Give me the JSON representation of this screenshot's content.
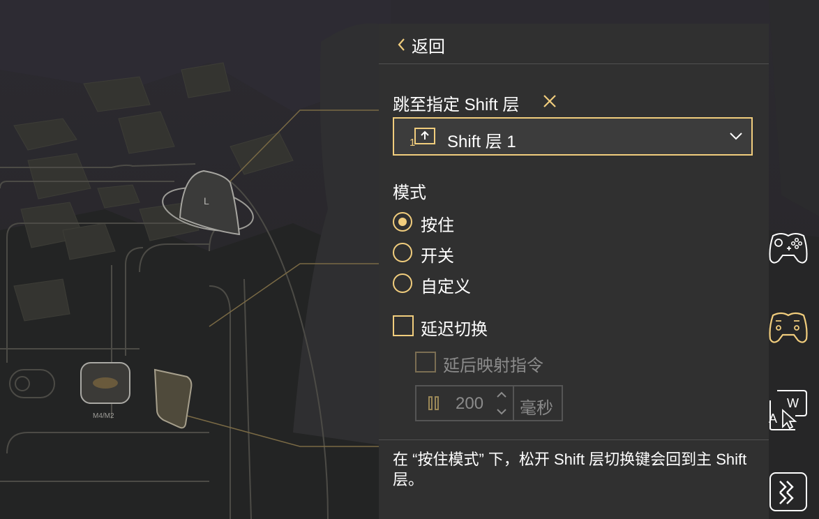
{
  "background": {
    "stick_label": "L",
    "paddle_label": "M4/M2"
  },
  "panel": {
    "back_label": "返回",
    "jump_title": "跳至指定 Shift 层",
    "clear_icon": "close-icon",
    "dropdown": {
      "icon": "shift-layer-icon",
      "selected": "Shift 层 1"
    },
    "mode_title": "模式",
    "modes": [
      {
        "label": "按住",
        "selected": true
      },
      {
        "label": "开关",
        "selected": false
      },
      {
        "label": "自定义",
        "selected": false
      }
    ],
    "delay_toggle": {
      "label": "延迟切换",
      "checked": false
    },
    "delay_mapping": {
      "label": "延后映射指令",
      "checked": false,
      "enabled": false
    },
    "delay_stepper": {
      "value": "200",
      "unit": "毫秒",
      "enabled": false
    },
    "note": "在 “按住模式” 下，松开 Shift 层切换键会回到主 Shift 层。"
  },
  "rail": [
    "controller-icon",
    "controller-active-icon",
    "keyboard-mouse-icon",
    "shortcut-icon"
  ],
  "colors": {
    "accent": "#f1cd7d",
    "panel_bg": "#303030",
    "dropdown_bg": "#3c3c3c",
    "disabled_text": "#8b8b8b"
  }
}
